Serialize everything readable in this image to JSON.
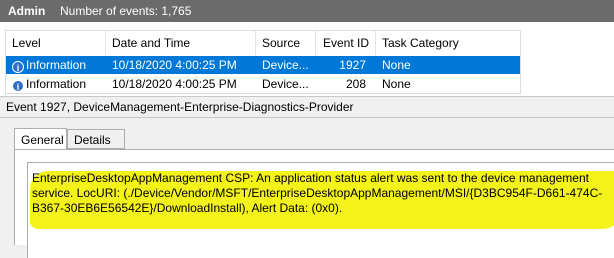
{
  "header": {
    "title": "Admin",
    "event_count": "Number of events: 1,765"
  },
  "grid": {
    "columns": [
      "Level",
      "Date and Time",
      "Source",
      "Event ID",
      "Task Category"
    ],
    "rows": [
      {
        "level": "Information",
        "date": "10/18/2020 4:00:25 PM",
        "source": "Device...",
        "event_id": "1927",
        "task": "None",
        "selected": true
      },
      {
        "level": "Information",
        "date": "10/18/2020 4:00:25 PM",
        "source": "Device...",
        "event_id": "208",
        "task": "None",
        "selected": false
      }
    ]
  },
  "detail": {
    "title": "Event 1927, DeviceManagement-Enterprise-Diagnostics-Provider",
    "tabs": [
      "General",
      "Details"
    ],
    "message_lines": [
      "EnterpriseDesktopAppManagement CSP: An application status alert was sent to the device management",
      "service. LocURI: (./Device/Vendor/MSFT/EnterpriseDesktopAppManagement/MSI/{D3BC954F-D661-474C-",
      "B367-30EB6E56542E}/DownloadInstall), Alert Data: (0x0)."
    ]
  },
  "colors": {
    "header_bg": "#6b6b6b",
    "selection": "#0078d7",
    "highlight": "#f3f21a",
    "info_icon": "#2f6fc6"
  },
  "icons": {
    "level_icon": "information-icon"
  }
}
